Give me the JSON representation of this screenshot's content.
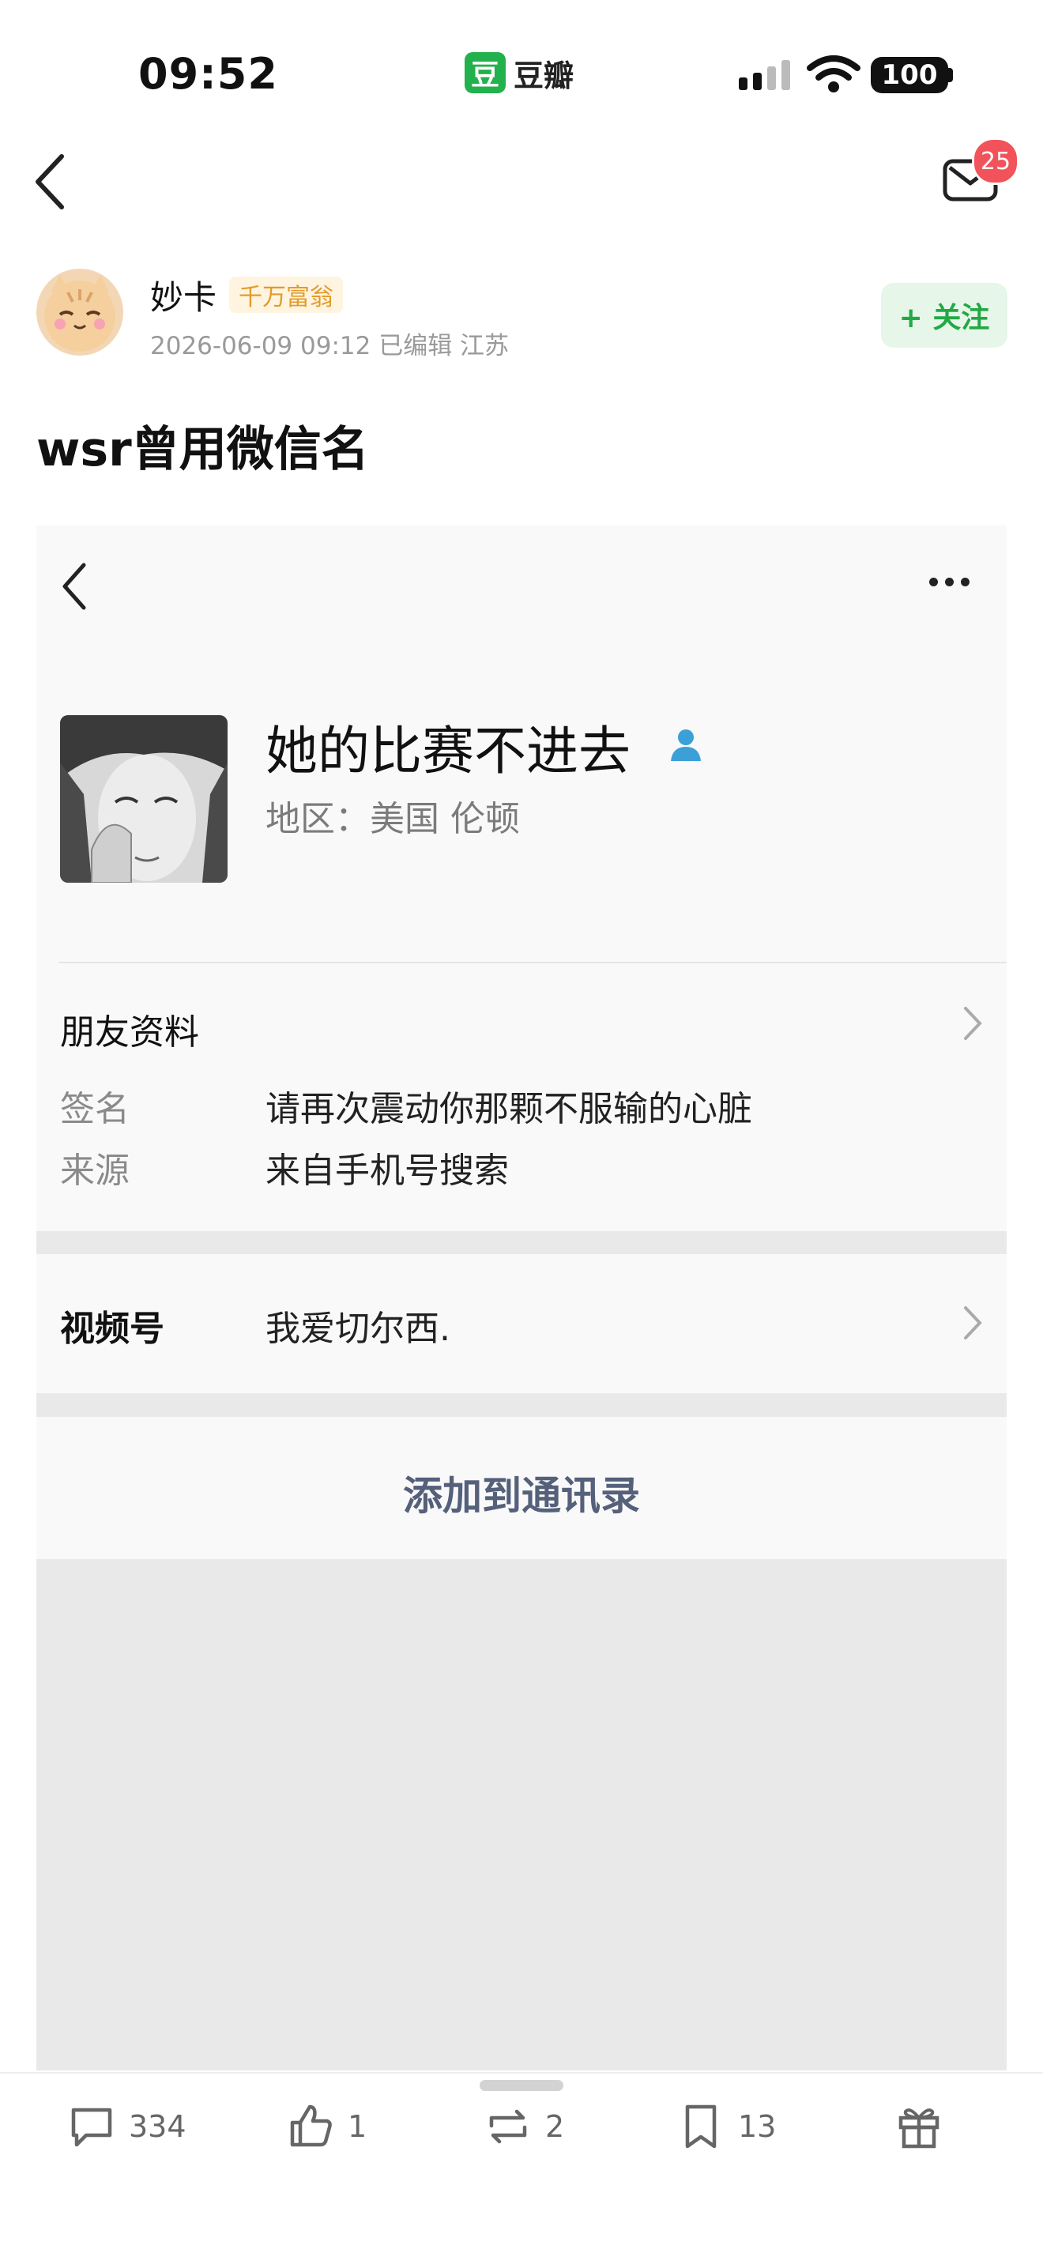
{
  "status_bar": {
    "time": "09:52",
    "carrier_logo": "豆",
    "carrier_name": "豆瓣",
    "battery": "100"
  },
  "header": {
    "mail_badge": "25"
  },
  "post": {
    "author": "妙卡",
    "rank_badge": "千万富翁",
    "meta": "2026-06-09 09:12  已编辑  江苏",
    "follow_label": "+ 关注",
    "title": "wsr曾用微信名"
  },
  "profile_screenshot": {
    "nickname": "她的比赛不进去",
    "region": "地区：美国 伦顿",
    "friend_info_label": "朋友资料",
    "signature_key": "签名",
    "signature_value": "请再次震动你那颗不服输的心脏",
    "source_key": "来源",
    "source_value": "来自手机号搜索",
    "channels_label": "视频号",
    "channels_value": "我爱切尔西.",
    "add_contact_label": "添加到通讯录"
  },
  "actions": {
    "comments": "334",
    "likes": "1",
    "reshares": "2",
    "bookmarks": "13"
  },
  "colors": {
    "follow_green": "#23a845",
    "badge_red": "#f2535a",
    "rank_orange": "#e39b2b"
  }
}
